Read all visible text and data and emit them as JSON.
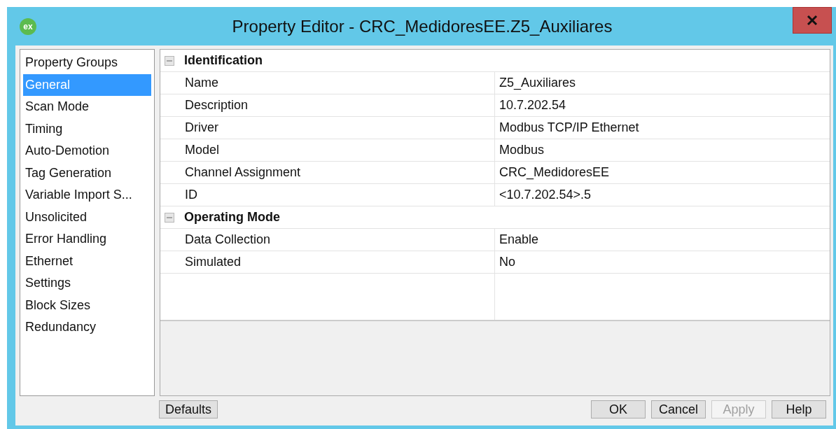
{
  "window": {
    "icon_text": "ex",
    "title": "Property Editor - CRC_MedidoresEE.Z5_Auxiliares"
  },
  "groups": {
    "header": "Property Groups",
    "items": [
      {
        "label": "General",
        "selected": true
      },
      {
        "label": "Scan Mode",
        "selected": false
      },
      {
        "label": "Timing",
        "selected": false
      },
      {
        "label": "Auto-Demotion",
        "selected": false
      },
      {
        "label": "Tag Generation",
        "selected": false
      },
      {
        "label": "Variable Import S...",
        "selected": false
      },
      {
        "label": "Unsolicited",
        "selected": false
      },
      {
        "label": "Error Handling",
        "selected": false
      },
      {
        "label": "Ethernet",
        "selected": false
      },
      {
        "label": "Settings",
        "selected": false
      },
      {
        "label": "Block Sizes",
        "selected": false
      },
      {
        "label": "Redundancy",
        "selected": false
      }
    ]
  },
  "sections": [
    {
      "title": "Identification",
      "expanded": true,
      "properties": [
        {
          "name": "Name",
          "value": "Z5_Auxiliares"
        },
        {
          "name": "Description",
          "value": "10.7.202.54"
        },
        {
          "name": "Driver",
          "value": "Modbus TCP/IP Ethernet"
        },
        {
          "name": "Model",
          "value": "Modbus"
        },
        {
          "name": "Channel Assignment",
          "value": "CRC_MedidoresEE"
        },
        {
          "name": "ID",
          "value": "<10.7.202.54>.5"
        }
      ]
    },
    {
      "title": "Operating Mode",
      "expanded": true,
      "properties": [
        {
          "name": "Data Collection",
          "value": "Enable"
        },
        {
          "name": "Simulated",
          "value": "No"
        }
      ]
    }
  ],
  "buttons": [
    {
      "label": "Defaults",
      "disabled": false
    },
    {
      "label": "OK",
      "disabled": false
    },
    {
      "label": "Cancel",
      "disabled": false
    },
    {
      "label": "Apply",
      "disabled": true
    },
    {
      "label": "Help",
      "disabled": false
    }
  ]
}
